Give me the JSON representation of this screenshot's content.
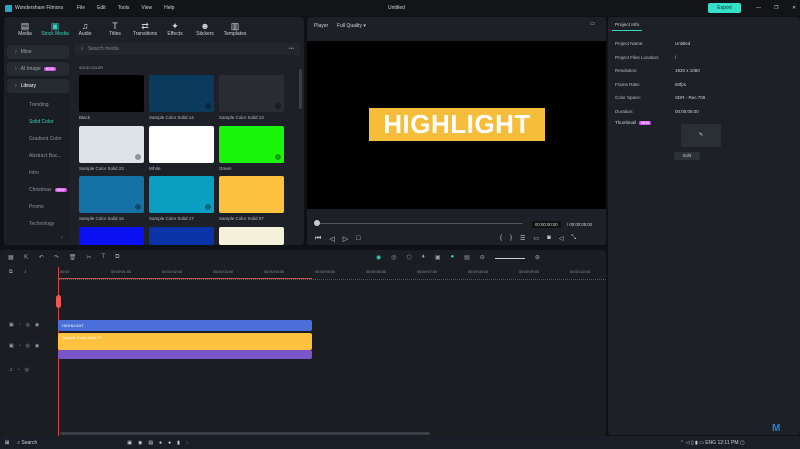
{
  "app": {
    "title": "Wondershare Filmora",
    "document_title": "Untitled",
    "export_label": "Export",
    "accent": "#36d6c0"
  },
  "menu": [
    "File",
    "Edit",
    "Tools",
    "View",
    "Help"
  ],
  "toolbar_tabs": [
    {
      "label": "Media",
      "icon": "media-icon"
    },
    {
      "label": "Stock Media",
      "icon": "stock-media-icon",
      "active": true
    },
    {
      "label": "Audio",
      "icon": "music-note-icon"
    },
    {
      "label": "Titles",
      "icon": "text-icon"
    },
    {
      "label": "Transitions",
      "icon": "transitions-icon"
    },
    {
      "label": "Effects",
      "icon": "effects-icon"
    },
    {
      "label": "Stickers",
      "icon": "stickers-icon"
    },
    {
      "label": "Templates",
      "icon": "templates-icon"
    }
  ],
  "sidebar": {
    "top": [
      {
        "label": "Mine"
      },
      {
        "label": "AI Image",
        "badge": "NEW"
      },
      {
        "label": "Library"
      }
    ],
    "sub": [
      {
        "label": "Trending"
      },
      {
        "label": "Solid Color",
        "active": true
      },
      {
        "label": "Gradient Color"
      },
      {
        "label": "Abstract Bac..."
      },
      {
        "label": "Intro"
      },
      {
        "label": "Christmas",
        "badge": "NEW"
      },
      {
        "label": "Promo"
      },
      {
        "label": "Technology"
      }
    ]
  },
  "search": {
    "placeholder": "Search media"
  },
  "section_title": "SOLID COLOR",
  "colors": [
    {
      "label": "Black",
      "color": "#000000"
    },
    {
      "label": "Sample Color Solid 14",
      "color": "#0b3a5c"
    },
    {
      "label": "Sample Color Solid 13",
      "color": "#2a2c33"
    },
    {
      "label": "Sample Color Solid 23",
      "color": "#dde3e6"
    },
    {
      "label": "White",
      "color": "#ffffff"
    },
    {
      "label": "Green",
      "color": "#1bf50a"
    },
    {
      "label": "Sample Color Solid 16",
      "color": "#1672a6"
    },
    {
      "label": "Sample Color Solid 17",
      "color": "#0ba0c2"
    },
    {
      "label": "Sample Color Solid 07",
      "color": "#fdc23e"
    },
    {
      "label": "",
      "color": "#0a10f0"
    },
    {
      "label": "",
      "color": "#0a33a8"
    },
    {
      "label": "",
      "color": "#f3f1da"
    }
  ],
  "player": {
    "label": "Player",
    "quality": "Full Quality",
    "preview_text": "HIGHLIGHT",
    "current_time": "00:00:00:00",
    "total_time": "/ 00:00:05:00"
  },
  "project_info": {
    "tab": "Project Info",
    "rows": [
      {
        "k": "Project Name:",
        "v": "Untitled"
      },
      {
        "k": "Project Files Location:",
        "v": "/"
      },
      {
        "k": "Resolution:",
        "v": "1920 x 1080"
      },
      {
        "k": "Frame Rate:",
        "v": "60fps"
      },
      {
        "k": "Color Space:",
        "v": "SDR - Rec.709"
      },
      {
        "k": "Duration:",
        "v": "00:00:05:00"
      }
    ],
    "thumbnail_label": "Thumbnail",
    "thumbnail_badge": "NEW",
    "edit_label": "Edit"
  },
  "timeline": {
    "ruler": [
      "00:00",
      "00:00:01:00",
      "00:00:02:00",
      "00:00:03:00",
      "00:00:04:00",
      "00:00:05:00",
      "00:00:06:00",
      "00:00:07:00",
      "00:00:08:00",
      "00:00:09:00",
      "00:00:10:00"
    ],
    "clips": [
      {
        "label": "HIGHLIGHT",
        "color": "#4a6fd8"
      },
      {
        "label": "Sample Color Solid 07",
        "color": "#fdc23e"
      },
      {
        "label": "",
        "color": "#7a55c8"
      }
    ]
  },
  "taskbar": {
    "search": "Search",
    "lang": "ENG",
    "clock": "12:11 PM"
  }
}
